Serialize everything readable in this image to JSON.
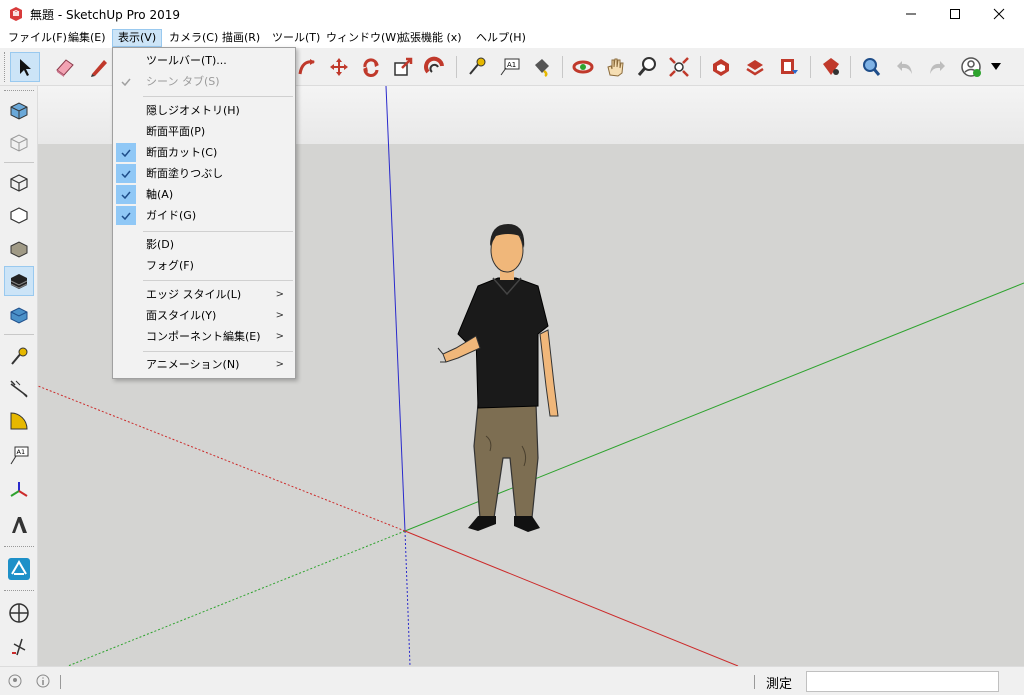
{
  "window": {
    "title": "無題 - SketchUp Pro 2019",
    "minimize_icon": "minimize-icon",
    "maximize_icon": "maximize-icon",
    "close_icon": "close-icon"
  },
  "menubar": {
    "items": [
      {
        "label": "ファイル(F)"
      },
      {
        "label": "編集(E)"
      },
      {
        "label": "表示(V)",
        "active": true
      },
      {
        "label": "カメラ(C)"
      },
      {
        "label": "描画(R)"
      },
      {
        "label": "ツール(T)"
      },
      {
        "label": "ウィンドウ(W)"
      },
      {
        "label": "拡張機能 (x)"
      },
      {
        "label": "ヘルプ(H)"
      }
    ]
  },
  "view_menu": {
    "items": [
      {
        "label": "ツールバー(T)...",
        "checked": false,
        "disabled": false,
        "submenu": false
      },
      {
        "label": "シーン タブ(S)",
        "checked": true,
        "disabled": true,
        "submenu": false
      },
      {
        "label": "隠しジオメトリ(H)",
        "checked": false,
        "disabled": false,
        "submenu": false
      },
      {
        "label": "断面平面(P)",
        "checked": false,
        "disabled": false,
        "submenu": false
      },
      {
        "label": "断面カット(C)",
        "checked": true,
        "disabled": false,
        "submenu": false
      },
      {
        "label": "断面塗りつぶし",
        "checked": true,
        "disabled": false,
        "submenu": false
      },
      {
        "label": "軸(A)",
        "checked": true,
        "disabled": false,
        "submenu": false
      },
      {
        "label": "ガイド(G)",
        "checked": true,
        "disabled": false,
        "submenu": false
      },
      {
        "label": "影(D)",
        "checked": false,
        "disabled": false,
        "submenu": false
      },
      {
        "label": "フォグ(F)",
        "checked": false,
        "disabled": false,
        "submenu": false
      },
      {
        "label": "エッジ スタイル(L)",
        "checked": false,
        "disabled": false,
        "submenu": true
      },
      {
        "label": "面スタイル(Y)",
        "checked": false,
        "disabled": false,
        "submenu": true
      },
      {
        "label": "コンポーネント編集(E)",
        "checked": false,
        "disabled": false,
        "submenu": true
      },
      {
        "label": "アニメーション(N)",
        "checked": false,
        "disabled": false,
        "submenu": true
      }
    ],
    "submenu_arrow": ">"
  },
  "toolbar": {
    "tools": [
      "select-tool-icon",
      "eraser-tool-icon",
      "pencil-tool-icon",
      "arc-tool-icon",
      "move-tool-icon",
      "rotate-tool-icon",
      "scale-tool-icon",
      "offset-tool-icon",
      "tape-measure-icon",
      "text-tool-icon",
      "paint-bucket-icon",
      "orbit-icon",
      "pan-icon",
      "zoom-icon",
      "zoom-extents-icon",
      "warehouse-icon",
      "extension-warehouse-icon",
      "layout-icon",
      "extension-manager-icon",
      "search-icon",
      "undo-icon",
      "redo-icon",
      "account-icon"
    ],
    "text_tool_label": "A1"
  },
  "left_toolbar": {
    "tools": [
      "iso-view-icon",
      "wireframe-box-icon",
      "back-edges-icon",
      "hidden-line-icon",
      "shaded-icon",
      "shaded-texture-icon",
      "monochrome-icon",
      "tape-measure-icon",
      "dimension-icon",
      "protractor-icon",
      "text-tool-icon",
      "axes-tool-icon",
      "3d-text-icon",
      "sandbox-icon",
      "position-camera-icon",
      "walk-icon"
    ],
    "text_tool_label": "A1"
  },
  "statusbar": {
    "measure_label": "測定",
    "measure_value": ""
  },
  "colors": {
    "sky": "#ececec",
    "ground": "#d4d4d2",
    "axis_red": "#cc2a2a",
    "axis_green": "#2ea32e",
    "axis_blue": "#2a2acc",
    "menu_highlight": "#cce4f7",
    "check_bg": "#90c8f6"
  }
}
